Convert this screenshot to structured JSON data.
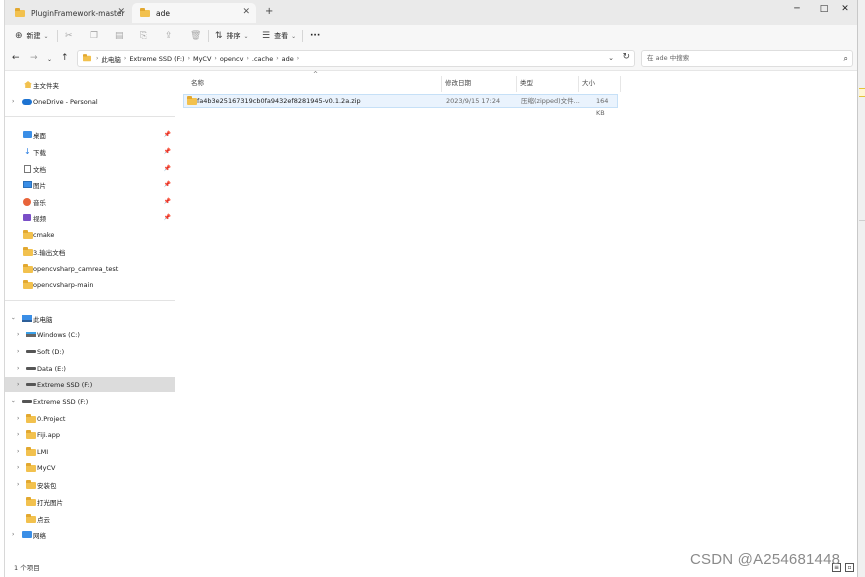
{
  "tabs": [
    {
      "label": "PluginFramework-master"
    },
    {
      "label": "ade"
    }
  ],
  "window_controls": {
    "minimize": "─",
    "maximize": "□",
    "close": "✕"
  },
  "toolbar": {
    "new_label": "新建",
    "sort_label": "排序",
    "view_label": "查看",
    "more_label": "···"
  },
  "address": {
    "crumbs": [
      "此电脑",
      "Extreme SSD (F:)",
      "MyCV",
      "opencv",
      ".cache",
      "ade"
    ]
  },
  "search": {
    "placeholder": "在 ade 中搜索"
  },
  "sidebar": {
    "quick": [
      {
        "label": "主文件夹",
        "icon": "home-icon"
      },
      {
        "label": "OneDrive - Personal",
        "icon": "onedrive-icon"
      }
    ],
    "pinned": [
      {
        "label": "桌面",
        "icon": "desktop-icon"
      },
      {
        "label": "下载",
        "icon": "download-icon"
      },
      {
        "label": "文档",
        "icon": "documents-icon"
      },
      {
        "label": "图片",
        "icon": "pictures-icon"
      },
      {
        "label": "音乐",
        "icon": "music-icon"
      },
      {
        "label": "视频",
        "icon": "videos-icon"
      },
      {
        "label": "cmake",
        "icon": "folder-icon"
      },
      {
        "label": "3.输出文档",
        "icon": "folder-icon"
      },
      {
        "label": "opencvsharp_camrea_test",
        "icon": "folder-icon"
      },
      {
        "label": "opencvsharp-main",
        "icon": "folder-icon"
      }
    ],
    "this_pc": {
      "label": "此电脑"
    },
    "drives": [
      {
        "label": "Windows (C:)"
      },
      {
        "label": "Soft (D:)"
      },
      {
        "label": "Data (E:)"
      },
      {
        "label": "Extreme SSD (F:)"
      }
    ],
    "ssd": {
      "label": "Extreme SSD (F:)"
    },
    "ssd_children": [
      {
        "label": "0.Project",
        "has_chevron": true
      },
      {
        "label": "Fiji.app",
        "has_chevron": true
      },
      {
        "label": "LMI",
        "has_chevron": true
      },
      {
        "label": "MyCV",
        "has_chevron": true
      },
      {
        "label": "安装包",
        "has_chevron": true
      },
      {
        "label": "打光图片",
        "has_chevron": false
      },
      {
        "label": "点云",
        "has_chevron": false
      }
    ],
    "network": {
      "label": "网络"
    }
  },
  "columns": {
    "name": "名称",
    "date": "修改日期",
    "type": "类型",
    "size": "大小"
  },
  "files": [
    {
      "name": "fa4b3e25167319cb0fa9432ef8281945-v0.1.2a.zip",
      "date": "2023/9/15 17:24",
      "type": "压缩(zipped)文件...",
      "size": "164 KB"
    }
  ],
  "status": {
    "count": "1 个项目"
  },
  "watermark": "CSDN @A254681448",
  "colors": {
    "accent": "#1e73d1",
    "folder": "#f2c14e",
    "selection": "#dcdcdc",
    "row_highlight": "#eaf3fd"
  }
}
